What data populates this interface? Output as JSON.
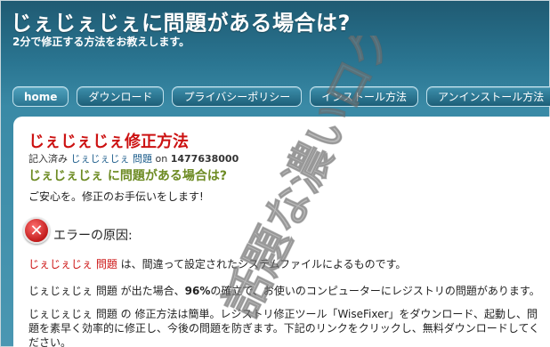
{
  "header": {
    "title": "じぇじぇじぇに問題がある場合は?",
    "subtitle": "2分で修正する方法をお教えします。"
  },
  "nav": {
    "items": [
      {
        "label": "home"
      },
      {
        "label": "ダウンロード"
      },
      {
        "label": "プライバシーポリシー"
      },
      {
        "label": "インストール方法"
      },
      {
        "label": "アンインストール方法"
      }
    ]
  },
  "article": {
    "title": "じぇじぇじぇ修正方法",
    "meta_prefix": "記入済み",
    "meta_link": "じぇじぇじぇ 問題",
    "meta_on": "on",
    "meta_date": "1477638000",
    "subtitle": "じぇじぇじぇ に問題がある場合は?",
    "intro": "ご安心を。修正のお手伝いをします!",
    "cause_label": "エラーの原因:",
    "p1_highlight": "じぇじぇじぇ 問題",
    "p1_text": " は、間違って設定されたシステムファイルによるものです。",
    "p2_pre": "じぇじぇじぇ 問題 が出た場合、",
    "p2_bold": "96%",
    "p2_post": "の確立で、お使いのコンピューターにレジストリの問題があります。",
    "p3": "じぇじぇじぇ 問題 の 修正方法は簡単。レジストリ修正ツール「WiseFixer」をダウンロード、起動し、問題を素早く効率的に修正し、今後の問題を防ぎます。下記のリンクをクリックし、無料ダウンロードしてください。"
  },
  "watermark": {
    "text": "話題な濃いログ"
  },
  "icons": {
    "error": "error-icon"
  },
  "colors": {
    "header_bg": "#2a7591",
    "title_red": "#cc1111",
    "subtitle_green": "#6d8b23",
    "link_blue": "#1a5b8a"
  }
}
